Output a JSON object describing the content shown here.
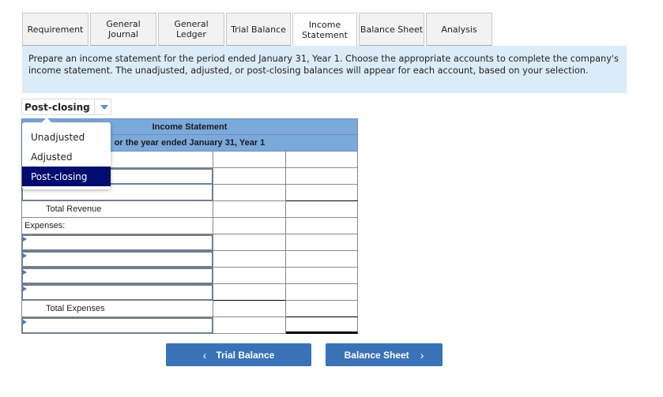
{
  "tabs": [
    {
      "label": "Requirement",
      "active": false
    },
    {
      "label": "General\nJournal",
      "line1": "General",
      "line2": "Journal",
      "active": false
    },
    {
      "label": "General\nLedger",
      "line1": "General",
      "line2": "Ledger",
      "active": false
    },
    {
      "label": "Trial Balance",
      "active": false
    },
    {
      "label": "Income\nStatement",
      "line1": "Income",
      "line2": "Statement",
      "active": true
    },
    {
      "label": "Balance Sheet",
      "active": false
    },
    {
      "label": "Analysis",
      "active": false
    }
  ],
  "instruction": "Prepare an income statement for the period ended January 31, Year 1. Choose the appropriate accounts to complete the company's income statement. The unadjusted, adjusted, or post-closing balances will appear for each account, based on your selection.",
  "balance_select": {
    "value": "Post-closing",
    "options": [
      "Unadjusted",
      "Adjusted",
      "Post-closing"
    ],
    "selected_index": 2
  },
  "statement": {
    "title": "Income Statement",
    "period": "For the year ended January 31, Year 1",
    "period_visible": "or the year ended January 31, Year 1",
    "rows": [
      {
        "type": "input",
        "label": ""
      },
      {
        "type": "input",
        "label": ""
      },
      {
        "type": "input",
        "label": ""
      },
      {
        "type": "total",
        "label": "Total Revenue"
      },
      {
        "type": "label",
        "label": "Expenses:"
      },
      {
        "type": "input",
        "label": ""
      },
      {
        "type": "input",
        "label": ""
      },
      {
        "type": "input",
        "label": ""
      },
      {
        "type": "input",
        "label": ""
      },
      {
        "type": "total",
        "label": "Total Expenses"
      },
      {
        "type": "input",
        "label": ""
      }
    ]
  },
  "nav": {
    "prev_label": "Trial Balance",
    "next_label": "Balance Sheet",
    "prev_icon": "chevron-left-icon",
    "next_icon": "chevron-right-icon"
  },
  "colors": {
    "accent": "#3a72b8",
    "header_blue": "#7ba9dc",
    "instruction_bg": "#dcebf8",
    "selected_option": "#000c6e"
  }
}
